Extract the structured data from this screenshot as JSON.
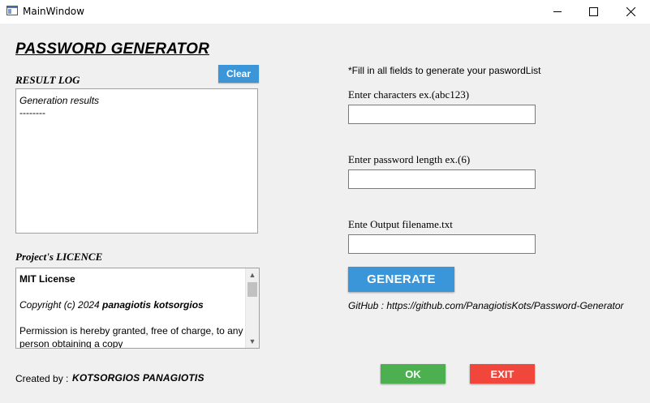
{
  "window": {
    "title": "MainWindow",
    "icon": "app-window-icon",
    "controls": [
      "minimize-icon",
      "maximize-icon",
      "close-icon"
    ]
  },
  "header": {
    "title": "PASSWORD GENERATOR"
  },
  "result_log": {
    "label": "RESULT LOG",
    "clear_label": "Clear",
    "lines": [
      "Generation results",
      "--------"
    ]
  },
  "licence": {
    "label": "Project's  LICENCE",
    "title": "MIT License",
    "copyright_prefix": "Copyright (c) 2024 ",
    "copyright_name": "panagiotis kotsorgios",
    "body_line1": "Permission is hereby granted, free of charge, to any",
    "body_line2": "person obtaining a copy"
  },
  "footer": {
    "created_label": "Created by :",
    "created_name": "KOTSORGIOS PANAGIOTIS"
  },
  "form": {
    "note": "*Fill in all fields to generate your paswordList",
    "characters_label": "Enter characters ex.(abc123)",
    "characters_value": "",
    "length_label": "Enter password length ex.(6)",
    "length_value": "",
    "filename_label": "Ente Output filename.txt",
    "filename_value": "",
    "generate_label": "GENERATE",
    "github": "GitHub : https://github.com/PanagiotisKots/Password-Generator"
  },
  "actions": {
    "ok_label": "OK",
    "exit_label": "EXIT"
  },
  "colors": {
    "accent": "#3b95d9",
    "ok": "#4caf50",
    "exit": "#f0463c"
  }
}
